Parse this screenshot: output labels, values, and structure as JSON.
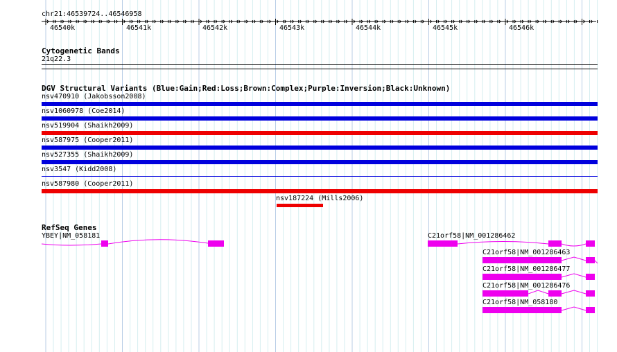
{
  "ruler": {
    "location": "chr21:46539724..46546958",
    "ticks": [
      "46540k",
      "46541k",
      "46542k",
      "46543k",
      "46544k",
      "46545k",
      "46546k"
    ]
  },
  "tracks": {
    "cytoband": {
      "title": "Cytogenetic Bands",
      "band": "21q22.3"
    },
    "dgv": {
      "title": "DGV Structural Variants (Blue:Gain;Red:Loss;Brown:Complex;Purple:Inversion;Black:Unknown)",
      "items": [
        {
          "label": "nsv470910 (Jakobsson2008)",
          "color": "#0000dd",
          "type": "Gain"
        },
        {
          "label": "nsv1060978 (Coe2014)",
          "color": "#0000dd",
          "type": "Gain"
        },
        {
          "label": "nsv519904 (Shaikh2009)",
          "color": "#ee0000",
          "type": "Loss"
        },
        {
          "label": "nsv587975 (Cooper2011)",
          "color": "#0000dd",
          "type": "Gain"
        },
        {
          "label": "nsv527355 (Shaikh2009)",
          "color": "#0000dd",
          "type": "Gain"
        },
        {
          "label": "nsv3547 (Kidd2008)",
          "color": "#0000dd",
          "type": "Gain"
        },
        {
          "label": "nsv587980 (Cooper2011)",
          "color": "#ee0000",
          "type": "Loss"
        },
        {
          "label": "nsv187224 (Mills2006)",
          "color": "#ee0000",
          "type": "Loss"
        }
      ]
    },
    "refseq": {
      "title": "RefSeq Genes",
      "color": "#ee00ee",
      "genes": [
        {
          "label": "YBEY|NM_058181"
        },
        {
          "label": "C21orf58|NM_001286462"
        },
        {
          "label": "C21orf58|NM_001286463"
        },
        {
          "label": "C21orf58|NM_001286477"
        },
        {
          "label": "C21orf58|NM_001286476"
        },
        {
          "label": "C21orf58|NM_058180"
        }
      ]
    }
  }
}
